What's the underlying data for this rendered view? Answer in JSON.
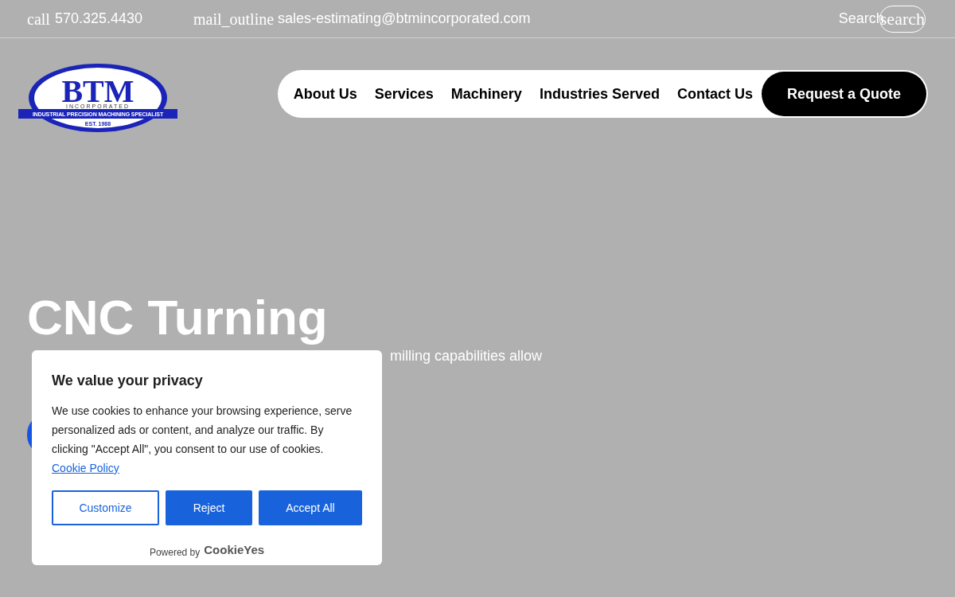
{
  "top_bar": {
    "phone_icon_text": "call",
    "phone": "570.325.4430",
    "mail_icon_text": "mail_outline",
    "email": "sales-estimating@btmincorporated.com",
    "search_label": "Search",
    "search_icon_text": "search"
  },
  "logo": {
    "name": "BTM",
    "sub": "INCORPORATED",
    "tagline": "INDUSTRIAL PRECISION MACHINING SPECIALIST",
    "est": "EST. 1988"
  },
  "nav": {
    "items": [
      "About Us",
      "Services",
      "Machinery",
      "Industries Served",
      "Contact Us"
    ],
    "cta": "Request a Quote"
  },
  "hero": {
    "title": "CNC Turning",
    "subtitle_fragment": "milling capabilities allow"
  },
  "cookie_banner": {
    "title": "We value your privacy",
    "body": "We use cookies to enhance your browsing experience, serve personalized ads or content, and analyze our traffic. By clicking \"Accept All\", you consent to our use of cookies.",
    "link": "Cookie Policy",
    "buttons": [
      {
        "label": "Customize",
        "kind": "outline"
      },
      {
        "label": "Reject",
        "kind": "filled"
      },
      {
        "label": "Accept All",
        "kind": "filled"
      }
    ],
    "powered_by": "Powered by",
    "brand": "CookieYes"
  }
}
